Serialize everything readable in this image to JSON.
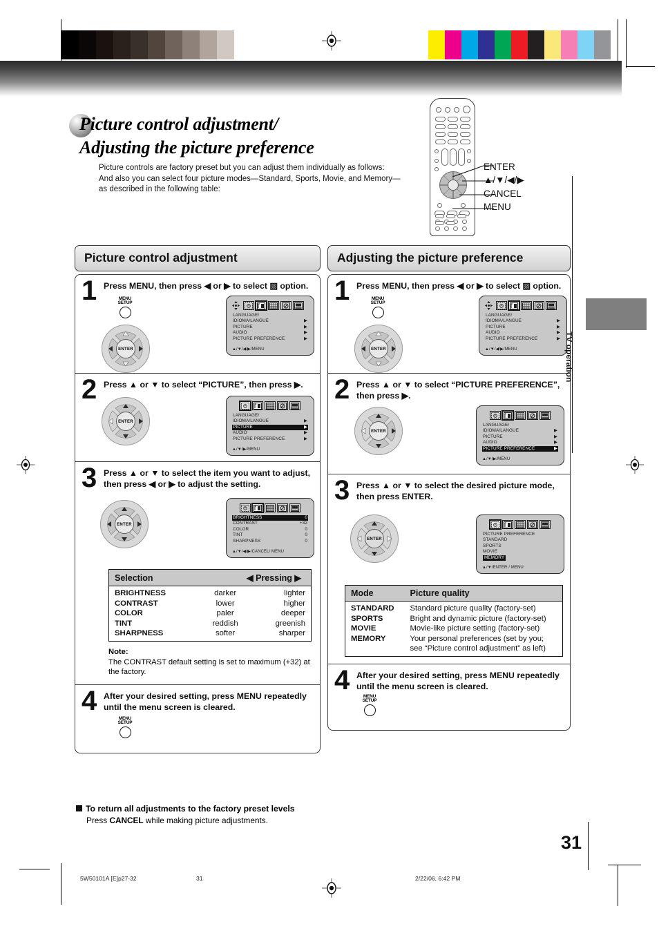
{
  "document": {
    "page_number": "31",
    "side_tab": "TV operation",
    "footer": {
      "file": "5W50101A [E]p27-32",
      "page": "31",
      "timestamp": "2/22/06, 6:42 PM"
    }
  },
  "title": {
    "line1": "Picture control adjustment/",
    "line2": "Adjusting the picture preference",
    "intro": "Picture controls are factory preset but you can adjust them individually as follows:\nAnd also you can select four picture modes—Standard, Sports, Movie, and Memory—as described in the following table:"
  },
  "remote_callouts": [
    {
      "label": "ENTER"
    },
    {
      "label": "▲/▼/◀/▶"
    },
    {
      "label": "CANCEL"
    },
    {
      "label": "MENU"
    }
  ],
  "osd_common": {
    "menu_items": [
      {
        "label": "LANGUAGE/",
        "arrow": ""
      },
      {
        "label": "IDIOMA/LANGUE",
        "arrow": "▶"
      },
      {
        "label": "PICTURE",
        "arrow": "▶"
      },
      {
        "label": "AUDIO",
        "arrow": "▶"
      },
      {
        "label": "PICTURE  PREFERENCE",
        "arrow": "▶"
      }
    ]
  },
  "left_column": {
    "header": "Picture control adjustment",
    "steps": [
      {
        "number": "1",
        "text": "Press MENU, then press ◀ or ▶ to select ▨ option.",
        "button_label_line1": "MENU",
        "button_label_line2": "SETUP",
        "osd": {
          "show_compass": true,
          "selected_icon_index": 1,
          "rows": [
            {
              "label": "LANGUAGE/",
              "value": "",
              "highlight": false
            },
            {
              "label": "   IDIOMA/LANGUE",
              "value": "▶",
              "highlight": false
            },
            {
              "label": "PICTURE",
              "value": "▶",
              "highlight": false
            },
            {
              "label": "AUDIO",
              "value": "▶",
              "highlight": false
            },
            {
              "label": "PICTURE  PREFERENCE",
              "value": "▶",
              "highlight": false
            }
          ],
          "footer": "▲/▼/◀/▶/MENU"
        }
      },
      {
        "number": "2",
        "text": "Press ▲ or ▼ to select “PICTURE”, then press ▶.",
        "osd": {
          "show_compass": false,
          "selected_icon_index": 0,
          "rows": [
            {
              "label": "LANGUAGE/",
              "value": "",
              "highlight": false
            },
            {
              "label": "   IDIOMA/LANGUE",
              "value": "▶",
              "highlight": false
            },
            {
              "label": "PICTURE",
              "value": "▶",
              "highlight": true
            },
            {
              "label": "AUDIO",
              "value": "▶",
              "highlight": false
            },
            {
              "label": "PICTURE  PREFERENCE",
              "value": "▶",
              "highlight": false
            }
          ],
          "footer": "▲/▼/▶/MENU"
        }
      },
      {
        "number": "3",
        "text": "Press ▲ or ▼ to select the item you want to adjust, then press ◀ or ▶ to adjust the setting.",
        "osd": {
          "show_compass": false,
          "selected_icon_index": 1,
          "rows": [
            {
              "label": "BRIGHTNESS",
              "value": "0",
              "highlight": true
            },
            {
              "label": "CONTRAST",
              "value": "+32",
              "highlight": false
            },
            {
              "label": "COLOR",
              "value": "0",
              "highlight": false
            },
            {
              "label": "TINT",
              "value": "0",
              "highlight": false
            },
            {
              "label": "SHARPNESS",
              "value": "0",
              "highlight": false
            }
          ],
          "footer": "▲/▼/◀/▶/CANCEL/ MENU"
        }
      },
      {
        "number": "4",
        "text": "After your desired setting, press MENU repeatedly until the menu screen is cleared.",
        "button_label_line1": "MENU",
        "button_label_line2": "SETUP"
      }
    ],
    "selection_table": {
      "headers": [
        "Selection",
        "◀  Pressing  ▶"
      ],
      "header_left": "Selection",
      "header_right": "◀  Pressing  ▶",
      "rows": [
        {
          "selection": "BRIGHTNESS",
          "left": "darker",
          "right": "lighter"
        },
        {
          "selection": "CONTRAST",
          "left": "lower",
          "right": "higher"
        },
        {
          "selection": "COLOR",
          "left": "paler",
          "right": "deeper"
        },
        {
          "selection": "TINT",
          "left": "reddish",
          "right": "greenish"
        },
        {
          "selection": "SHARPNESS",
          "left": "softer",
          "right": "sharper"
        }
      ]
    },
    "note": {
      "title": "Note:",
      "body": "The CONTRAST default setting is set to maximum (+32) at the factory."
    }
  },
  "right_column": {
    "header": "Adjusting the picture preference",
    "steps": [
      {
        "number": "1",
        "text": "Press MENU, then press ◀ or ▶ to select ▨ option.",
        "button_label_line1": "MENU",
        "button_label_line2": "SETUP",
        "osd": {
          "show_compass": true,
          "selected_icon_index": 1,
          "rows": [
            {
              "label": "LANGUAGE/",
              "value": "",
              "highlight": false
            },
            {
              "label": "   IDIOMA/LANGUE",
              "value": "▶",
              "highlight": false
            },
            {
              "label": "PICTURE",
              "value": "▶",
              "highlight": false
            },
            {
              "label": "AUDIO",
              "value": "▶",
              "highlight": false
            },
            {
              "label": "PICTURE  PREFERENCE",
              "value": "▶",
              "highlight": false
            }
          ],
          "footer": "▲/▼/◀/▶/MENU"
        }
      },
      {
        "number": "2",
        "text": "Press ▲ or ▼ to select “PICTURE PREFERENCE”, then press ▶.",
        "osd": {
          "show_compass": false,
          "selected_icon_index": 1,
          "rows": [
            {
              "label": "LANGUAGE/",
              "value": "",
              "highlight": false
            },
            {
              "label": "   IDIOMA/LANGUE",
              "value": "▶",
              "highlight": false
            },
            {
              "label": "PICTURE",
              "value": "▶",
              "highlight": false
            },
            {
              "label": "AUDIO",
              "value": "▶",
              "highlight": false
            },
            {
              "label": "PICTURE  PREFERENCE",
              "value": "▶",
              "highlight": true
            }
          ],
          "footer": "▲/▼/▶/MENU"
        }
      },
      {
        "number": "3",
        "text": "Press ▲ or ▼ to select the desired picture mode, then press ENTER.",
        "osd": {
          "show_compass": false,
          "selected_icon_index": 0,
          "rows": [
            {
              "label": "PICTURE PREFERENCE",
              "value": "",
              "highlight": false
            },
            {
              "label": "  STANDARD",
              "value": "",
              "highlight": false
            },
            {
              "label": "  SPORTS",
              "value": "",
              "highlight": false
            },
            {
              "label": "  MOVIE",
              "value": "",
              "highlight": false
            },
            {
              "label": "  MEMORY",
              "value": "",
              "highlight": true
            }
          ],
          "footer": "▲/▼/ENTER / MENU"
        }
      },
      {
        "number": "4",
        "text": "After your desired setting, press MENU repeatedly until the menu screen is cleared.",
        "button_label_line1": "MENU",
        "button_label_line2": "SETUP"
      }
    ],
    "mode_table": {
      "header_left": "Mode",
      "header_right": "Picture quality",
      "rows": [
        {
          "mode": "STANDARD",
          "quality": "Standard picture quality (factory-set)"
        },
        {
          "mode": "SPORTS",
          "quality": "Bright and dynamic picture (factory-set)"
        },
        {
          "mode": "MOVIE",
          "quality": "Movie-like picture setting (factory-set)"
        },
        {
          "mode": "MEMORY",
          "quality": "Your personal preferences (set by you;\nsee “Picture control adjustment” as left)"
        }
      ]
    }
  },
  "return_note": {
    "heading": "To return all adjustments to the factory preset levels",
    "body_pre": "Press ",
    "body_bold": "CANCEL",
    "body_post": " while making picture adjustments."
  },
  "print_marks": {
    "grayscale": [
      "#000000",
      "#0a0706",
      "#1a120f",
      "#2a201c",
      "#3a302a",
      "#51453e",
      "#6f635c",
      "#8e817a",
      "#b0a49d",
      "#d2c8c2",
      "#ffffff"
    ],
    "colors": [
      "#fdee00",
      "#ec008c",
      "#00a9e6",
      "#2e3192",
      "#00a651",
      "#ed1c24",
      "#231f20",
      "#fbe87a",
      "#f67fb5",
      "#7fd4f5",
      "#939598"
    ]
  }
}
